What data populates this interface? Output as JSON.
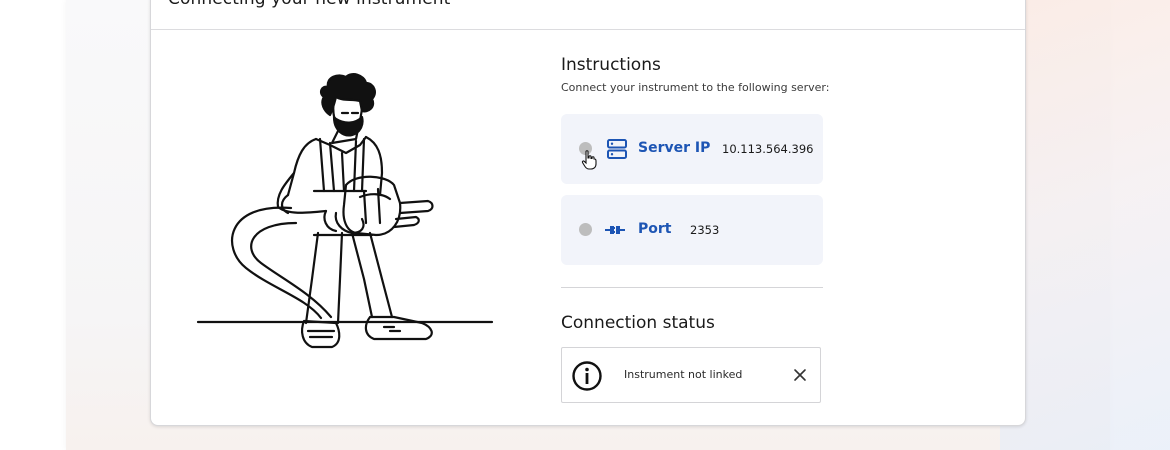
{
  "card": {
    "title": "Connecting your new instrument"
  },
  "instructions": {
    "title": "Instructions",
    "subtitle": "Connect your instrument to the following server:",
    "server": {
      "label": "Server IP",
      "value": "10.113.564.396",
      "icon": "server-icon"
    },
    "port": {
      "label": "Port",
      "value": "2353",
      "icon": "plug-icon"
    }
  },
  "connection_status": {
    "title": "Connection status",
    "message": "Instrument not linked",
    "info_icon": "info-icon",
    "close_icon": "close-icon"
  },
  "colors": {
    "accent": "#1d55b4",
    "radio_inactive": "#bdbdbd",
    "info_box_bg": "#f2f4fa"
  }
}
